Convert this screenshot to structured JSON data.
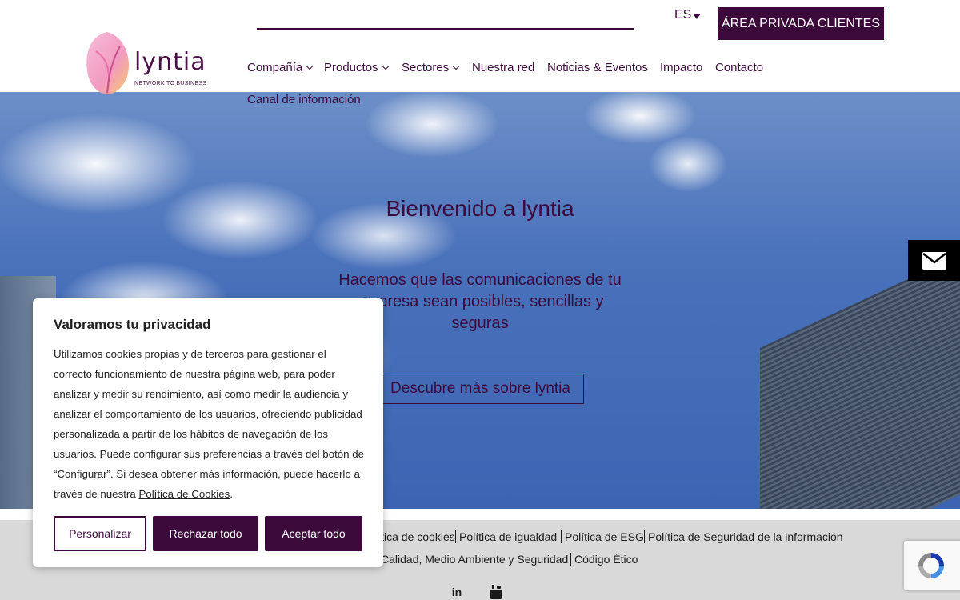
{
  "header": {
    "logo_text": "lyntia",
    "logo_tagline": "NETWORK TO BUSINESS",
    "lang": "ES",
    "private_area": "ÁREA PRIVADA CLIENTES"
  },
  "nav": {
    "items": [
      {
        "label": "Compañía"
      },
      {
        "label": "Productos"
      },
      {
        "label": "Sectores"
      },
      {
        "label": "Nuestra red"
      },
      {
        "label": "Noticias & Eventos"
      },
      {
        "label": "Impacto"
      },
      {
        "label": "Contacto"
      },
      {
        "label": "Canal de información"
      }
    ]
  },
  "hero": {
    "title": "Bienvenido a lyntia",
    "subtitle": "Hacemos que las comunicaciones de tu empresa sean posibles, sencillas y seguras",
    "cta": "Descubre más sobre lyntia"
  },
  "footer": {
    "links": [
      "Política de cookies",
      "Política de igualdad",
      "Política de ESG",
      "Política de Seguridad de la información",
      "Calidad, Medio Ambiente y Seguridad",
      "Código Ético"
    ],
    "social": [
      "linkedin-icon",
      "youtube-icon"
    ]
  },
  "cookie": {
    "title": "Valoramos tu privacidad",
    "body": "Utilizamos cookies propias y de terceros para gestionar el correcto funcionamiento de nuestra página web, para poder analizar y medir su rendimiento, así como medir la audiencia y analizar el comportamiento de los usuarios, ofreciendo publicidad personalizada a partir de los hábitos de navegación de los usuarios. Puede configurar sus preferencias a través del botón de “Configurar”. Si desea obtener más información, puede hacerlo a través de nuestra ",
    "policy_link": "Política de Cookies",
    "body_end": ".",
    "customize": "Personalizar",
    "reject": "Rechazar todo",
    "accept": "Aceptar todo"
  },
  "colors": {
    "brand": "#3b0a3a",
    "footer_bg": "#d9d9d9"
  }
}
